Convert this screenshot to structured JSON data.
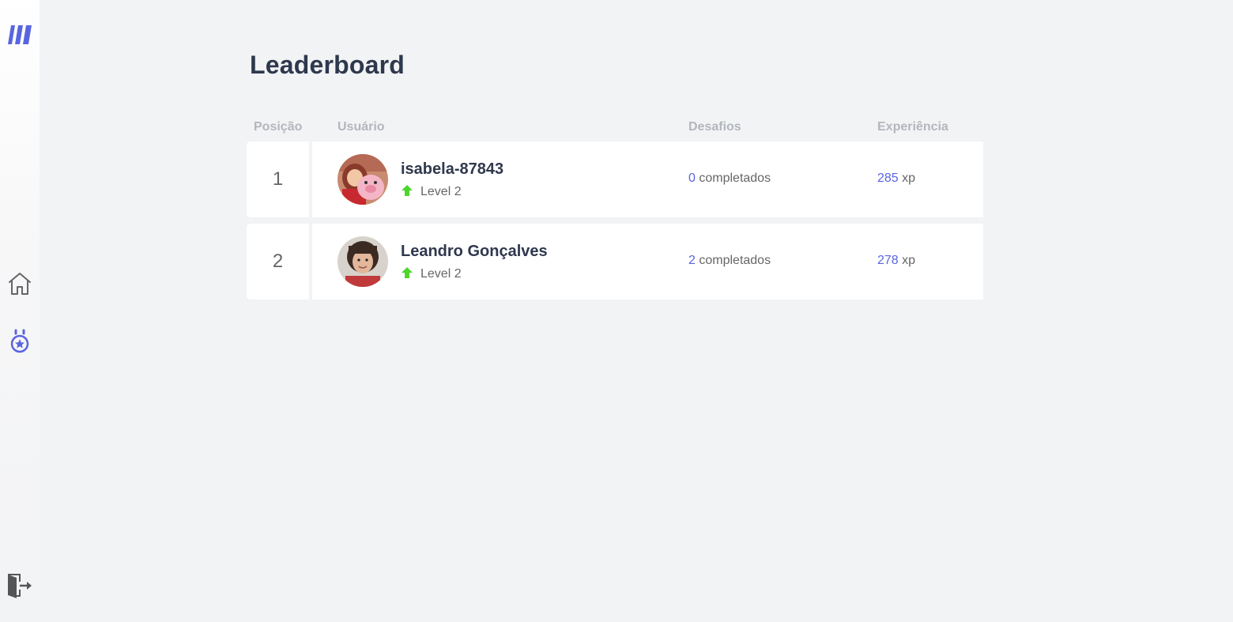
{
  "app": {
    "logo_icon": "moveit-logo-icon",
    "accent_color": "#5965e0",
    "level_up_color": "#4cd62b"
  },
  "sidebar": {
    "items": [
      {
        "icon": "home-icon",
        "active": false
      },
      {
        "icon": "award-icon",
        "active": true
      }
    ],
    "logout_icon": "logout-icon"
  },
  "page": {
    "title": "Leaderboard"
  },
  "table": {
    "headers": {
      "position": "Posição",
      "user": "Usuário",
      "challenges": "Desafios",
      "experience": "Experiência"
    },
    "rows": [
      {
        "position": "1",
        "name": "isabela-87843",
        "level": "Level 2",
        "challenges_count": "0",
        "challenges_label": "completados",
        "xp_value": "285",
        "xp_unit": "xp"
      },
      {
        "position": "2",
        "name": "Leandro Gonçalves",
        "level": "Level 2",
        "challenges_count": "2",
        "challenges_label": "completados",
        "xp_value": "278",
        "xp_unit": "xp"
      }
    ]
  }
}
